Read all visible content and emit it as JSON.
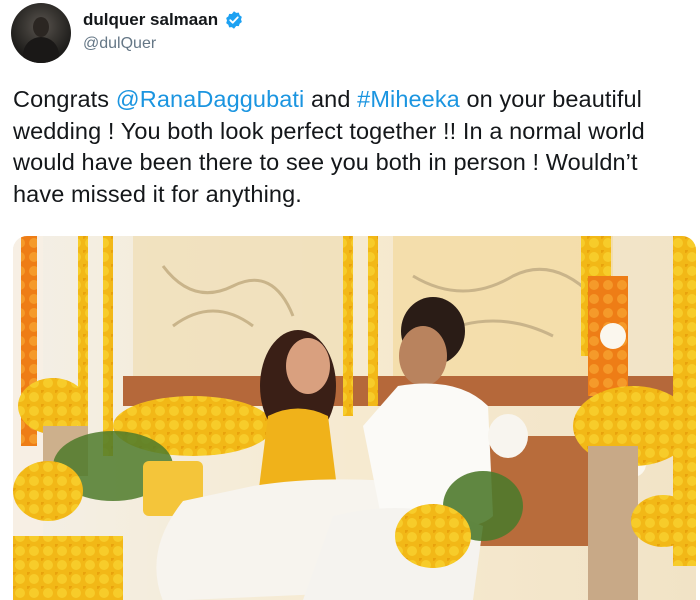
{
  "author": {
    "display_name": "dulquer salmaan",
    "handle": "@dulQuer",
    "avatar_icon": "profile-photo",
    "verified_icon": "verified-badge-icon",
    "verified_color": "#1da1f2"
  },
  "tweet": {
    "text_1": "Congrats ",
    "mention": "@RanaDaggubati",
    "text_2": " and ",
    "hashtag": "#Miheeka",
    "text_3": " on your beautiful wedding ! You both look perfect together !! In a normal world would have been there to see you both in person ! Wouldn’t have missed it for anything.",
    "link_color": "#1b95e0"
  },
  "media": {
    "type": "photo"
  }
}
